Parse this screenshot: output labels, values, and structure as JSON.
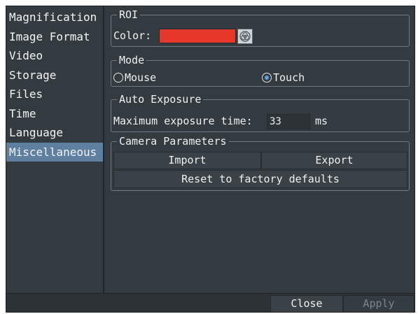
{
  "sidebar": {
    "items": [
      {
        "label": "Magnification",
        "active": false
      },
      {
        "label": "Image Format",
        "active": false
      },
      {
        "label": "Video",
        "active": false
      },
      {
        "label": "Storage",
        "active": false
      },
      {
        "label": "Files",
        "active": false
      },
      {
        "label": "Time",
        "active": false
      },
      {
        "label": "Language",
        "active": false
      },
      {
        "label": "Miscellaneous",
        "active": true
      }
    ]
  },
  "roi": {
    "title": "ROI",
    "color_label": "Color:",
    "color_value": "#e5372a",
    "picker_icon": "color-wheel-icon"
  },
  "mode": {
    "title": "Mode",
    "options": [
      {
        "label": "Mouse",
        "checked": false
      },
      {
        "label": "Touch",
        "checked": true
      }
    ]
  },
  "auto_exposure": {
    "title": "Auto Exposure",
    "max_label": "Maximum exposure time:",
    "max_value": "33",
    "unit": "ms"
  },
  "camera_parameters": {
    "title": "Camera Parameters",
    "import_label": "Import",
    "export_label": "Export",
    "reset_label": "Reset to factory defaults"
  },
  "footer": {
    "close_label": "Close",
    "apply_label": "Apply",
    "apply_enabled": false
  },
  "colors": {
    "active_item": "#5f7fa1",
    "radio_checked": "#5f9fe0",
    "panel_bg": "#343b40"
  }
}
